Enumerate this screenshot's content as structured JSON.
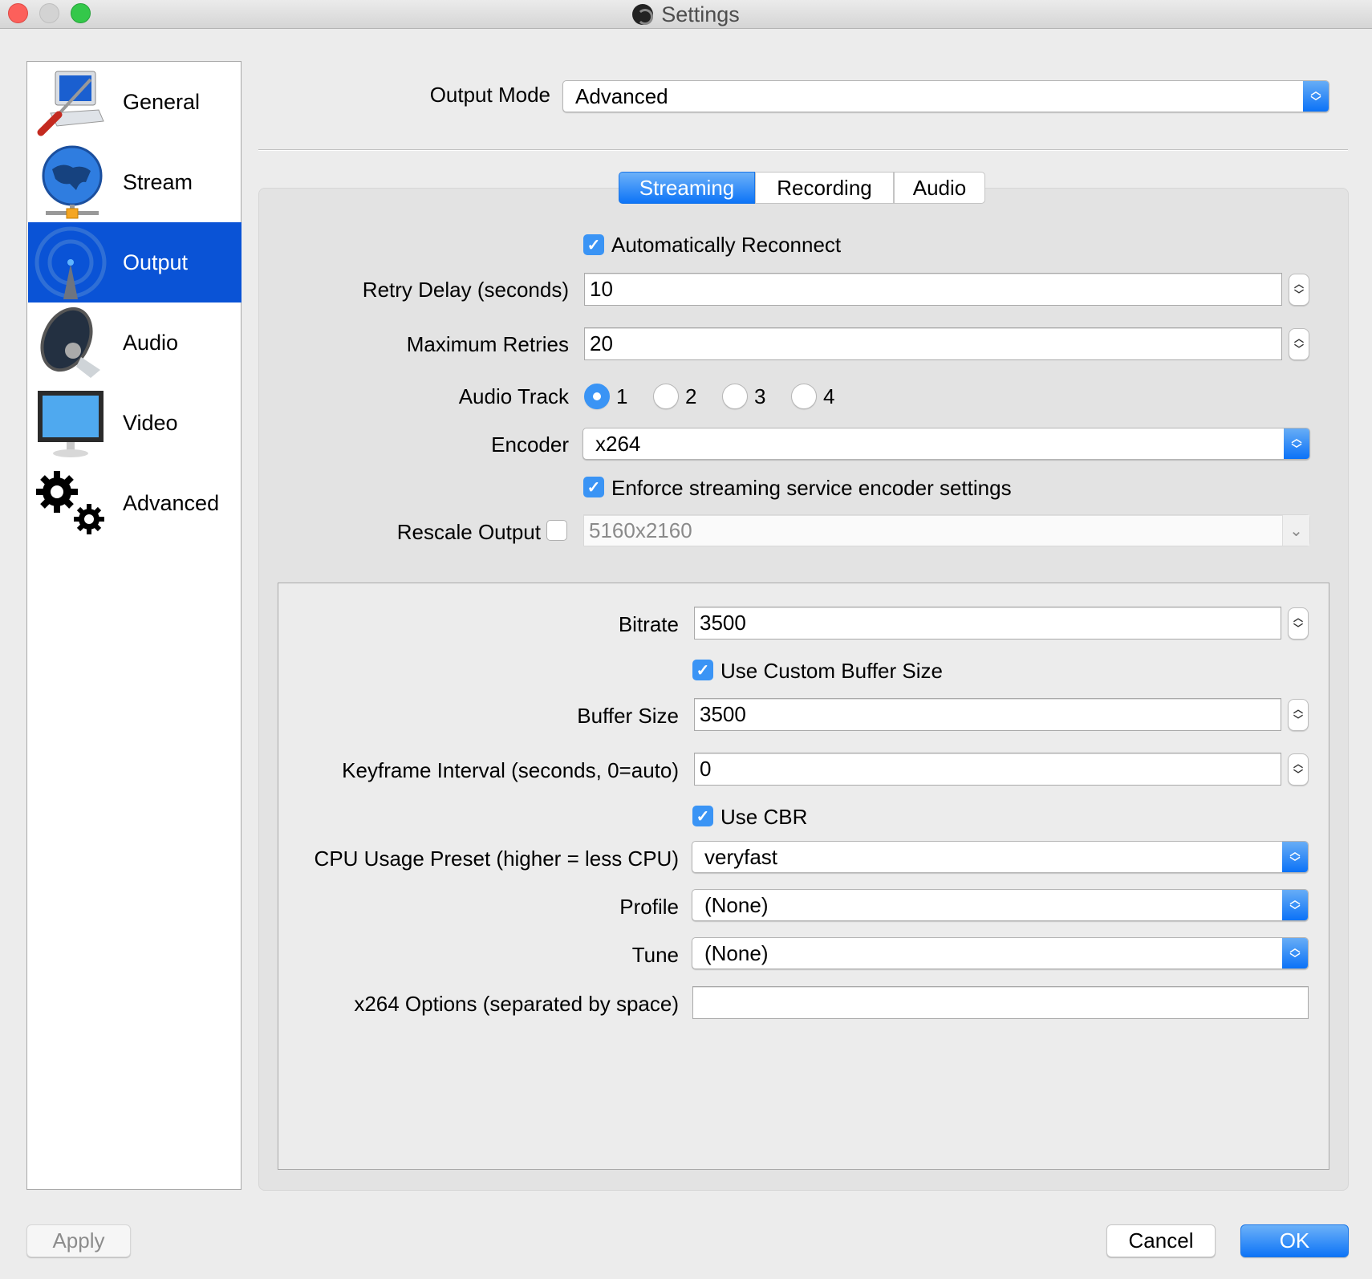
{
  "window": {
    "title": "Settings"
  },
  "sidebar": {
    "items": [
      {
        "label": "General",
        "icon": "general-icon",
        "selected": false
      },
      {
        "label": "Stream",
        "icon": "globe-icon",
        "selected": false
      },
      {
        "label": "Output",
        "icon": "antenna-icon",
        "selected": true
      },
      {
        "label": "Audio",
        "icon": "speaker-icon",
        "selected": false
      },
      {
        "label": "Video",
        "icon": "monitor-icon",
        "selected": false
      },
      {
        "label": "Advanced",
        "icon": "gears-icon",
        "selected": false
      }
    ]
  },
  "output_mode": {
    "label": "Output Mode",
    "value": "Advanced"
  },
  "tabs": [
    {
      "label": "Streaming",
      "active": true
    },
    {
      "label": "Recording",
      "active": false
    },
    {
      "label": "Audio",
      "active": false
    }
  ],
  "streaming": {
    "auto_reconnect": {
      "label": "Automatically Reconnect",
      "checked": true
    },
    "retry_delay": {
      "label": "Retry Delay (seconds)",
      "value": "10"
    },
    "max_retries": {
      "label": "Maximum Retries",
      "value": "20"
    },
    "audio_track": {
      "label": "Audio Track",
      "options": [
        "1",
        "2",
        "3",
        "4"
      ],
      "selected": "1"
    },
    "encoder": {
      "label": "Encoder",
      "value": "x264"
    },
    "enforce": {
      "label": "Enforce streaming service encoder settings",
      "checked": true
    },
    "rescale": {
      "label": "Rescale Output",
      "checked": false,
      "value": "5160x2160"
    }
  },
  "encoder_settings": {
    "bitrate": {
      "label": "Bitrate",
      "value": "3500"
    },
    "custom_buffer": {
      "label": "Use Custom Buffer Size",
      "checked": true
    },
    "buffer_size": {
      "label": "Buffer Size",
      "value": "3500"
    },
    "keyframe": {
      "label": "Keyframe Interval (seconds, 0=auto)",
      "value": "0"
    },
    "cbr": {
      "label": "Use CBR",
      "checked": true
    },
    "cpu_preset": {
      "label": "CPU Usage Preset (higher = less CPU)",
      "value": "veryfast"
    },
    "profile": {
      "label": "Profile",
      "value": "(None)"
    },
    "tune": {
      "label": "Tune",
      "value": "(None)"
    },
    "x264_options": {
      "label": "x264 Options (separated by space)",
      "value": ""
    }
  },
  "buttons": {
    "apply": "Apply",
    "cancel": "Cancel",
    "ok": "OK"
  },
  "glyphs": {
    "check": "✓",
    "up": "︿",
    "down": "﹀",
    "chev_down": "⌄"
  }
}
